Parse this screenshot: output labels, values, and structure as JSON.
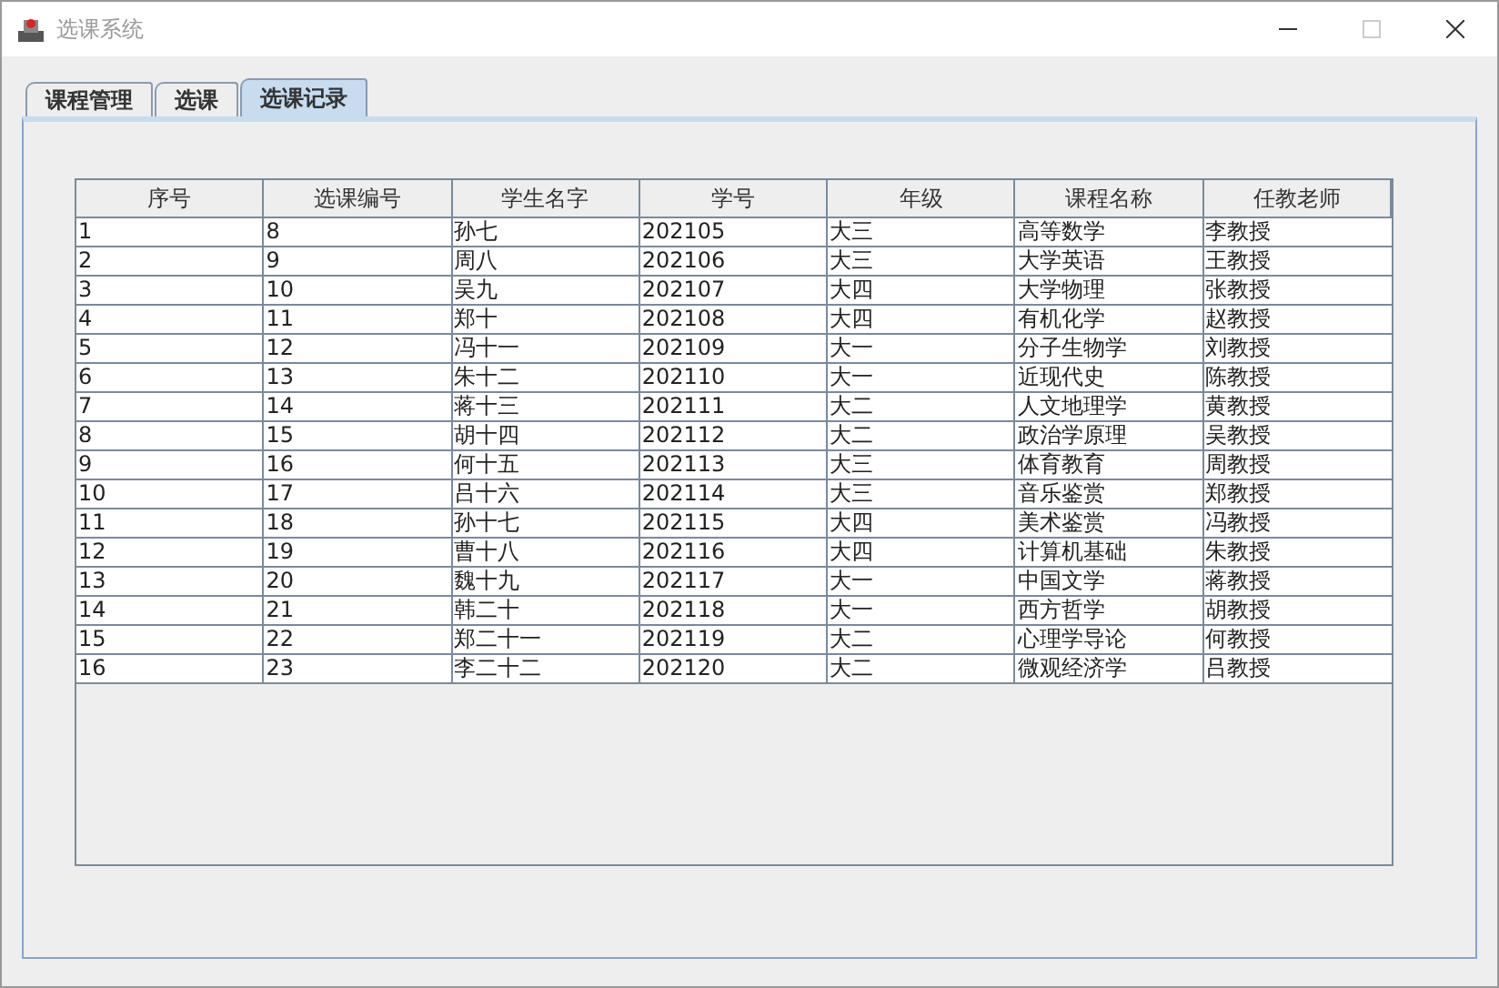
{
  "window": {
    "title": "选课系统"
  },
  "tabs": [
    {
      "label": "课程管理",
      "selected": false
    },
    {
      "label": "选课",
      "selected": false
    },
    {
      "label": "选课记录",
      "selected": true
    }
  ],
  "table": {
    "columns": [
      "序号",
      "选课编号",
      "学生名字",
      "学号",
      "年级",
      "课程名称",
      "任教老师"
    ],
    "rows": [
      [
        "1",
        "8",
        "孙七",
        "202105",
        "大三",
        "高等数学",
        "李教授"
      ],
      [
        "2",
        "9",
        "周八",
        "202106",
        "大三",
        "大学英语",
        "王教授"
      ],
      [
        "3",
        "10",
        "吴九",
        "202107",
        "大四",
        "大学物理",
        "张教授"
      ],
      [
        "4",
        "11",
        "郑十",
        "202108",
        "大四",
        "有机化学",
        "赵教授"
      ],
      [
        "5",
        "12",
        "冯十一",
        "202109",
        "大一",
        "分子生物学",
        "刘教授"
      ],
      [
        "6",
        "13",
        "朱十二",
        "202110",
        "大一",
        "近现代史",
        "陈教授"
      ],
      [
        "7",
        "14",
        "蒋十三",
        "202111",
        "大二",
        "人文地理学",
        "黄教授"
      ],
      [
        "8",
        "15",
        "胡十四",
        "202112",
        "大二",
        "政治学原理",
        "吴教授"
      ],
      [
        "9",
        "16",
        "何十五",
        "202113",
        "大三",
        "体育教育",
        "周教授"
      ],
      [
        "10",
        "17",
        "吕十六",
        "202114",
        "大三",
        "音乐鉴赏",
        "郑教授"
      ],
      [
        "11",
        "18",
        "孙十七",
        "202115",
        "大四",
        "美术鉴赏",
        "冯教授"
      ],
      [
        "12",
        "19",
        "曹十八",
        "202116",
        "大四",
        "计算机基础",
        "朱教授"
      ],
      [
        "13",
        "20",
        "魏十九",
        "202117",
        "大一",
        "中国文学",
        "蒋教授"
      ],
      [
        "14",
        "21",
        "韩二十",
        "202118",
        "大一",
        "西方哲学",
        "胡教授"
      ],
      [
        "15",
        "22",
        "郑二十一",
        "202119",
        "大二",
        "心理学导论",
        "何教授"
      ],
      [
        "16",
        "23",
        "李二十二",
        "202120",
        "大二",
        "微观经济学",
        "吕教授"
      ]
    ]
  }
}
